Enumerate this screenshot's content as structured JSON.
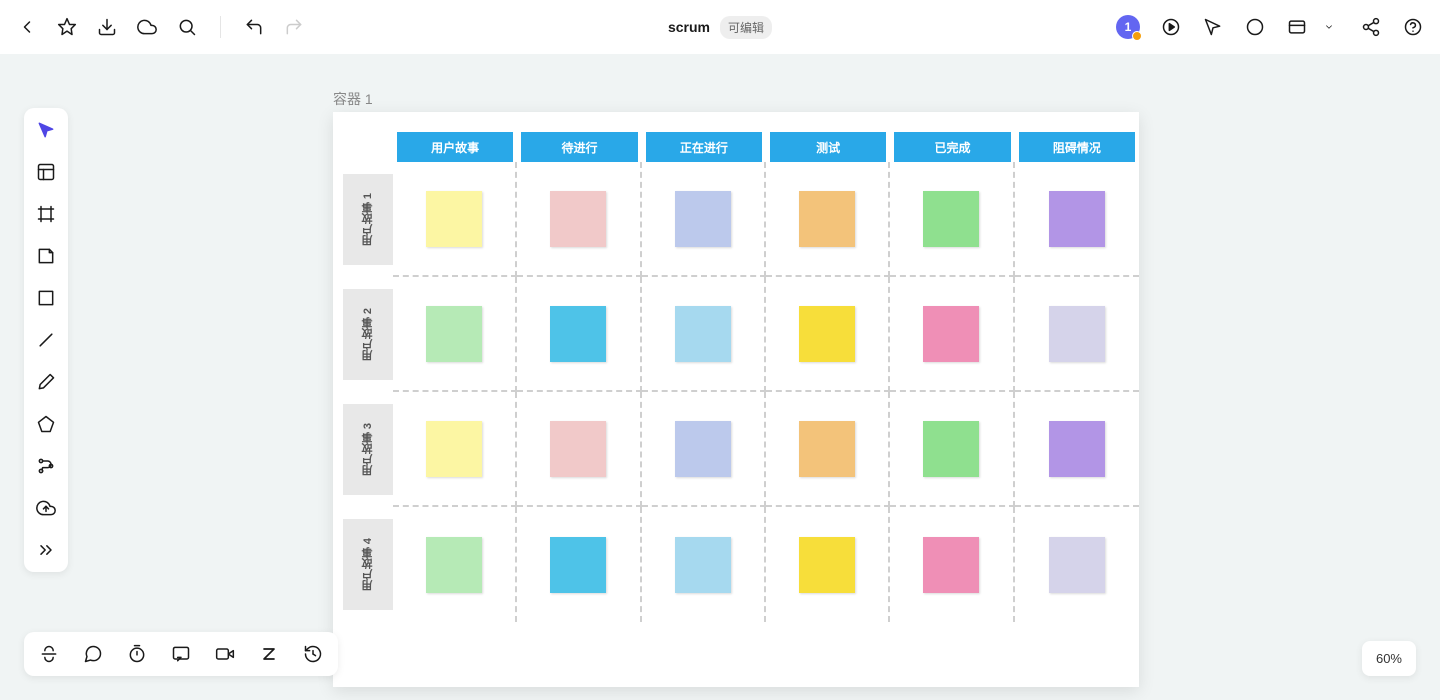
{
  "header": {
    "title": "scrum",
    "badge": "可编辑",
    "user_count": "1"
  },
  "canvas": {
    "container_label": "容器 1",
    "zoom": "60%"
  },
  "board": {
    "columns": [
      "用户故事",
      "待进行",
      "正在进行",
      "测试",
      "已完成",
      "阻碍情况"
    ],
    "rows": [
      "用户故事 1",
      "用户故事 2",
      "用户故事 3",
      "用户故事 4"
    ],
    "stickies": [
      [
        "#fcf6a3",
        "#f1c9c9",
        "#bcc9ec",
        "#f3c37a",
        "#8fe08f",
        "#b295e6"
      ],
      [
        "#b6eab6",
        "#4ec3e8",
        "#a6d9ef",
        "#f7de3a",
        "#ef8fb6",
        "#d5d3ea"
      ],
      [
        "#fcf6a3",
        "#f1c9c9",
        "#bcc9ec",
        "#f3c37a",
        "#8fe08f",
        "#b295e6"
      ],
      [
        "#b6eab6",
        "#4ec3e8",
        "#a6d9ef",
        "#f7de3a",
        "#ef8fb6",
        "#d5d3ea"
      ]
    ]
  }
}
